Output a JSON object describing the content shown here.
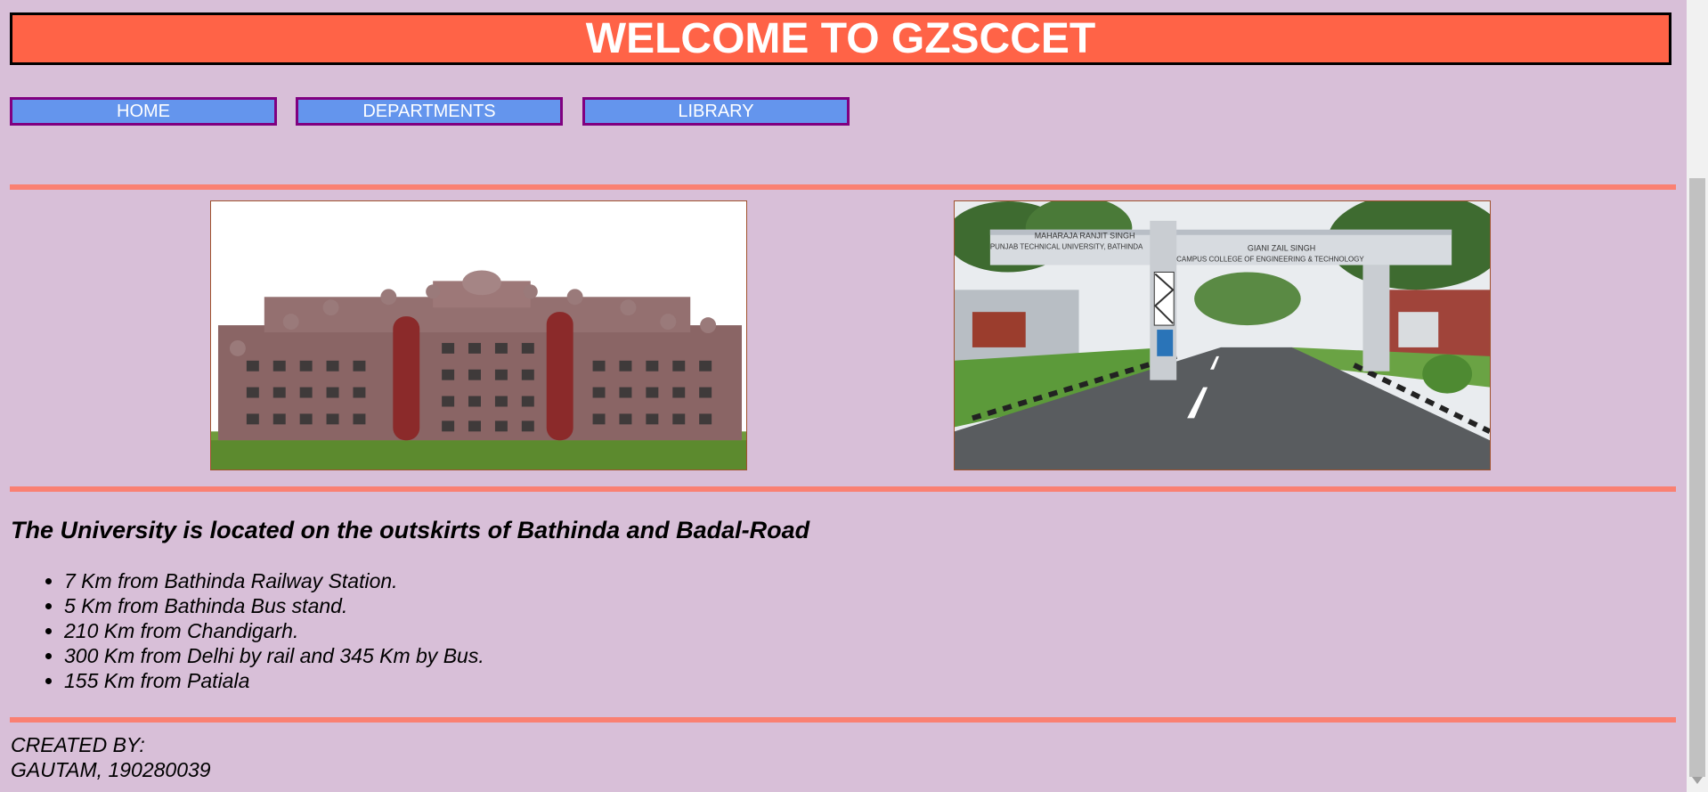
{
  "header": {
    "title": "WELCOME TO GZSCCET"
  },
  "nav": {
    "items": [
      {
        "label": "HOME"
      },
      {
        "label": "DEPARTMENTS"
      },
      {
        "label": "LIBRARY"
      }
    ]
  },
  "photos": {
    "gate": {
      "sign_left_line1": "MAHARAJA RANJIT SINGH",
      "sign_left_line2": "PUNJAB TECHNICAL UNIVERSITY, BATHINDA",
      "sign_right_line1": "GIANI ZAIL SINGH",
      "sign_right_line2": "CAMPUS COLLEGE OF ENGINEERING & TECHNOLOGY"
    }
  },
  "location": {
    "heading": "The University is located on the outskirts of Bathinda and Badal-Road",
    "items": [
      "7 Km from Bathinda Railway Station.",
      "5 Km from Bathinda Bus stand.",
      "210 Km from Chandigarh.",
      "300 Km from Delhi by rail and 345 Km by Bus.",
      "155 Km from Patiala"
    ]
  },
  "footer": {
    "created_by_label": "CREATED BY:",
    "author": "GAUTAM, 190280039"
  },
  "colors": {
    "background": "#d8bfd8",
    "header_bg": "#ff6347",
    "nav_bg": "#6495ed",
    "nav_border": "#800080",
    "divider": "#fa8072"
  }
}
